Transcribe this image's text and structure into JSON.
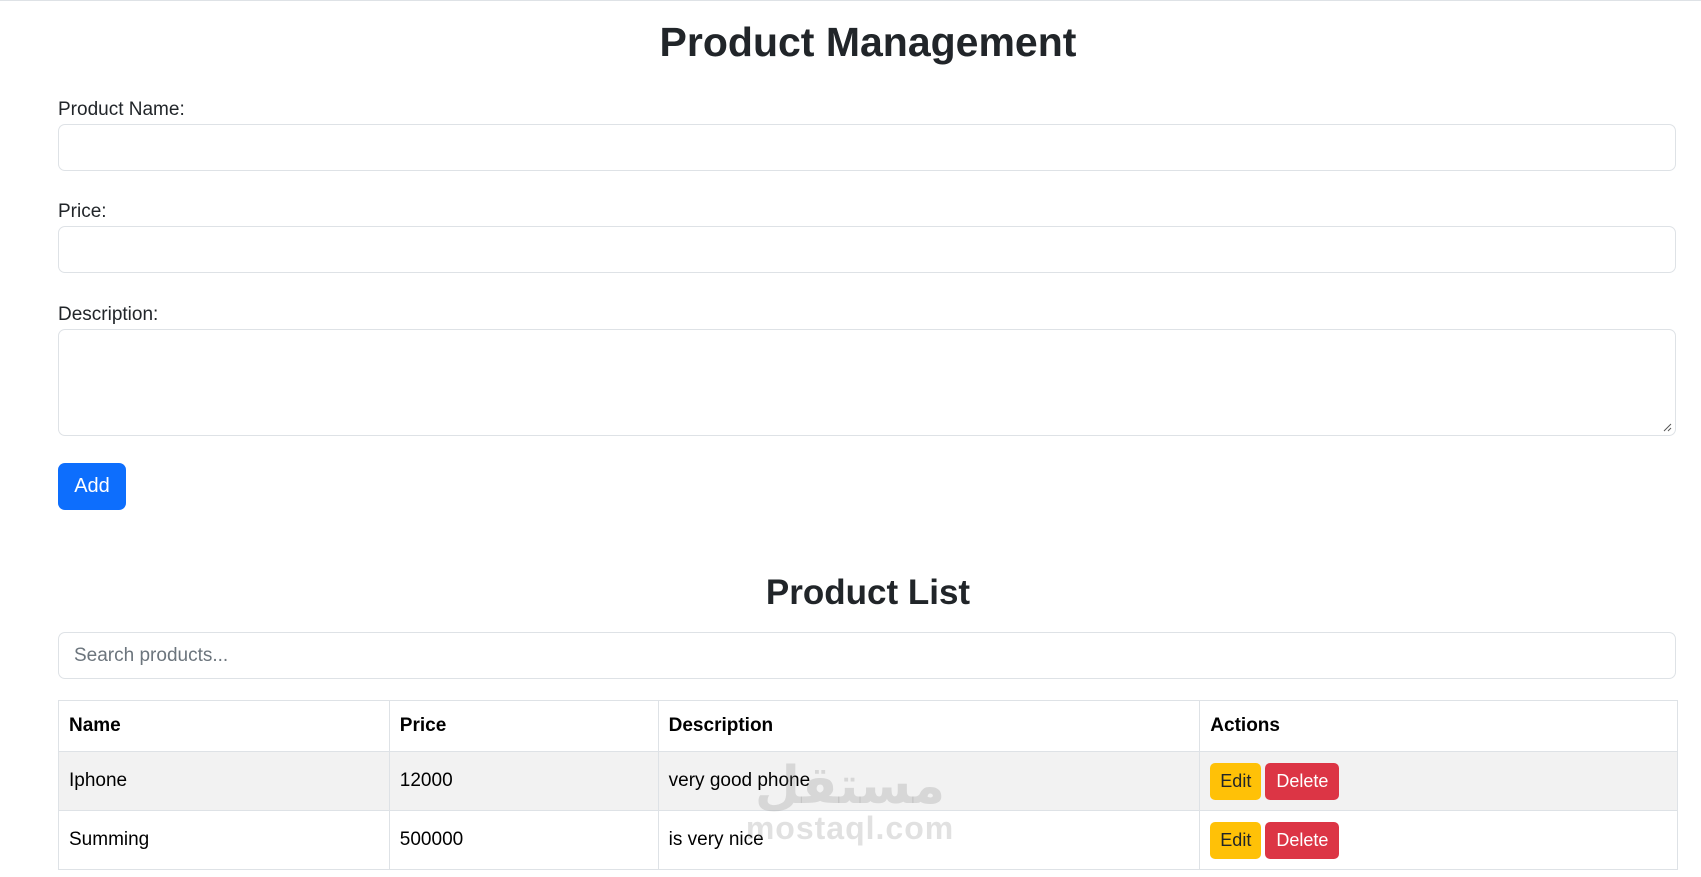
{
  "page": {
    "title": "Product Management"
  },
  "form": {
    "name_label": "Product Name:",
    "name_value": "",
    "price_label": "Price:",
    "price_value": "",
    "description_label": "Description:",
    "description_value": "",
    "add_label": "Add"
  },
  "list": {
    "title": "Product List",
    "search_placeholder": "Search products...",
    "columns": [
      "Name",
      "Price",
      "Description",
      "Actions"
    ],
    "rows": [
      {
        "name": "Iphone",
        "price": "12000",
        "description": "very good phone",
        "edit": "Edit",
        "delete": "Delete"
      },
      {
        "name": "Summing",
        "price": "500000",
        "description": "is very nice",
        "edit": "Edit",
        "delete": "Delete"
      }
    ]
  },
  "watermark": {
    "arabic": "مستقل",
    "latin": "mostaql.com"
  },
  "colors": {
    "primary": "#0d6efd",
    "warning": "#ffc107",
    "danger": "#dc3545",
    "striped_row": "#f2f2f2",
    "border": "#dee2e6"
  }
}
